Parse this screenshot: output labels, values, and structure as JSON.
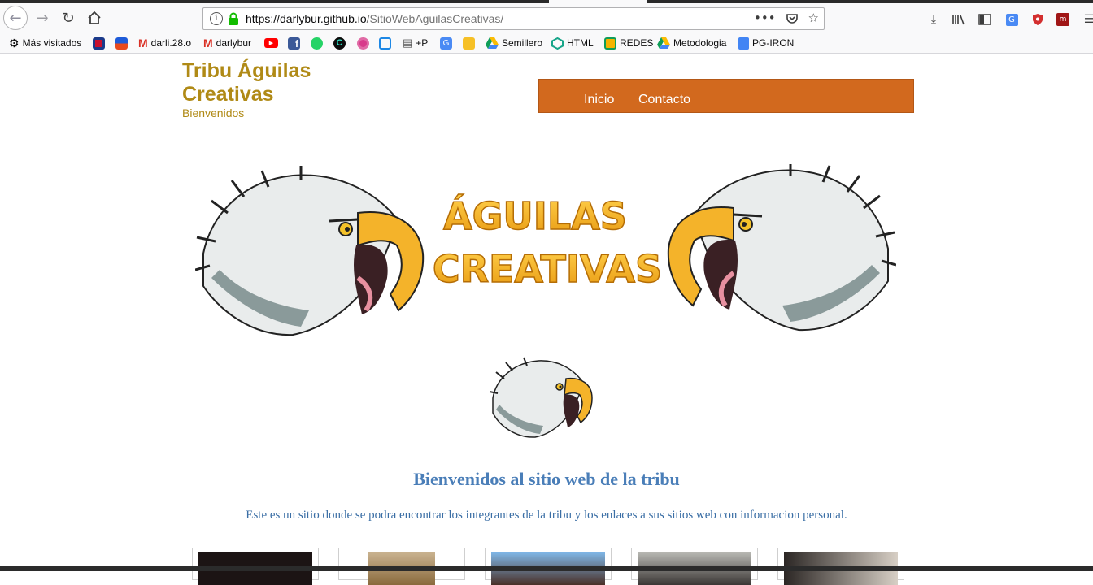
{
  "browser": {
    "url_domain": "https://darlybur.github.io",
    "url_path": "/SitioWebAguilasCreativas/",
    "bookmarks": [
      {
        "label": "Más visitados",
        "icon": "gear-icon"
      },
      {
        "label": "",
        "icon": "app-red-icon"
      },
      {
        "label": "",
        "icon": "app-blue-icon"
      },
      {
        "label": "darli.28.o",
        "icon": "gmail-icon"
      },
      {
        "label": "darlybur",
        "icon": "gmail-icon"
      },
      {
        "label": "",
        "icon": "youtube-icon"
      },
      {
        "label": "",
        "icon": "facebook-icon"
      },
      {
        "label": "",
        "icon": "whatsapp-icon"
      },
      {
        "label": "",
        "icon": "c-icon"
      },
      {
        "label": "",
        "icon": "circle-icon"
      },
      {
        "label": "",
        "icon": "tv-icon"
      },
      {
        "label": "+P",
        "icon": "film-icon"
      },
      {
        "label": "",
        "icon": "translate-icon"
      },
      {
        "label": "",
        "icon": "keep-icon"
      },
      {
        "label": "Semillero",
        "icon": "drive-icon"
      },
      {
        "label": "HTML",
        "icon": "codepen-icon"
      },
      {
        "label": "REDES",
        "icon": "classroom-icon"
      },
      {
        "label": "Metodologia",
        "icon": "drive-icon"
      },
      {
        "label": "PG-IRON",
        "icon": "docs-icon"
      }
    ]
  },
  "site": {
    "title": "Tribu Águilas Creativas",
    "subtitle": "Bienvenidos",
    "nav": [
      "Inicio",
      "Contacto"
    ],
    "banner_text_1": "ÁGUILAS",
    "banner_text_2": "CREATIVAS",
    "welcome_heading": "Bienvenidos al sitio web de la tribu",
    "description": "Este es un sitio donde se podra encontrar los integrantes de la tribu y los enlaces a sus sitios web con informacion personal."
  },
  "colors": {
    "title": "#b08a16",
    "menu": "#d2691e",
    "heading": "#4a7eb8",
    "banner_text": "#f4b32a"
  }
}
